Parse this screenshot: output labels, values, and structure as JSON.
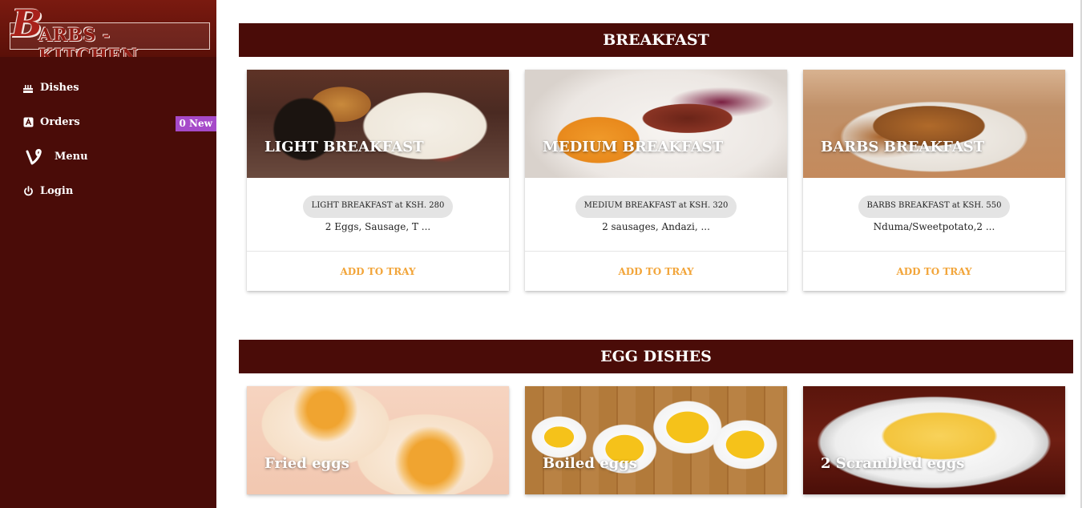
{
  "brand": {
    "logo_initial": "B",
    "logo_text": "ARBS - KITCHEN",
    "colors": {
      "sidebar": "#4a0c08",
      "accent": "#f2a53a",
      "badge": "#a64ac9"
    }
  },
  "sidebar": {
    "items": [
      {
        "label": "Dishes",
        "icon": "cake-icon"
      },
      {
        "label": "Orders",
        "icon": "orders-icon",
        "badge": "0 New"
      },
      {
        "label": "Menu",
        "icon": "vine-icon"
      },
      {
        "label": "Login",
        "icon": "power-icon"
      }
    ]
  },
  "sections": [
    {
      "title": "BREAKFAST",
      "cards": [
        {
          "title": "LIGHT BREAKFAST",
          "chip": "LIGHT BREAKFAST at KSH. 280",
          "desc": "2 Eggs, Sausage, T ...",
          "action": "ADD TO TRAY"
        },
        {
          "title": "MEDIUM BREAKFAST",
          "chip": "MEDIUM BREAKFAST at KSH. 320",
          "desc": "2 sausages, Andazi, ...",
          "action": "ADD TO TRAY"
        },
        {
          "title": "BARBS BREAKFAST",
          "chip": "BARBS BREAKFAST at KSH. 550",
          "desc": "Nduma/Sweetpotato,2 ...",
          "action": "ADD TO TRAY"
        }
      ]
    },
    {
      "title": "EGG DISHES",
      "cards": [
        {
          "title": "Fried eggs"
        },
        {
          "title": "Boiled eggs"
        },
        {
          "title": "2 Scrambled eggs"
        }
      ]
    }
  ]
}
